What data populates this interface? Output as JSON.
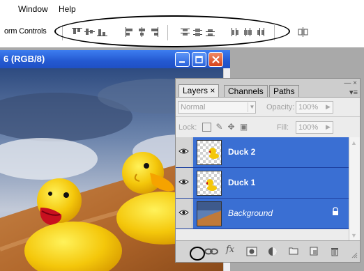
{
  "menu": {
    "window": "Window",
    "help": "Help"
  },
  "options_bar": {
    "label": "orm Controls",
    "icons": [
      "align-top-edges-icon",
      "align-vertical-centers-icon",
      "align-bottom-edges-icon",
      "align-left-edges-icon",
      "align-horizontal-centers-icon",
      "align-right-edges-icon",
      "distribute-top-edges-icon",
      "distribute-vertical-centers-icon",
      "distribute-bottom-edges-icon",
      "distribute-left-edges-icon",
      "distribute-horizontal-centers-icon",
      "distribute-right-edges-icon",
      "auto-align-layers-icon"
    ]
  },
  "document": {
    "title": "6 (RGB/8)",
    "buttons": [
      "minimize",
      "maximize",
      "close"
    ]
  },
  "layers_panel": {
    "tabs": [
      "Layers",
      "Channels",
      "Paths"
    ],
    "active_tab": "Layers",
    "tab_close": "×",
    "blend_mode": "Normal",
    "opacity_label": "Opacity:",
    "opacity_value": "100%",
    "lock_label": "Lock:",
    "fill_label": "Fill:",
    "fill_value": "100%",
    "layers": [
      {
        "name": "Duck 2",
        "visible": true,
        "selected": true,
        "locked": false,
        "italic": false
      },
      {
        "name": "Duck 1",
        "visible": true,
        "selected": true,
        "locked": false,
        "italic": false
      },
      {
        "name": "Background",
        "visible": true,
        "selected": true,
        "locked": true,
        "italic": true
      }
    ],
    "bottom_icons": [
      "link-layers-icon",
      "fx-layer-style-icon",
      "layer-mask-icon",
      "adjustment-layer-icon",
      "new-group-icon",
      "new-layer-icon",
      "trash-icon"
    ],
    "fx_label": "fx"
  },
  "colors": {
    "selection_blue": "#3a6fd3",
    "titlebar_blue": "#2459d1",
    "close_red": "#d6421a",
    "workspace_gray": "#a9a9a9"
  }
}
